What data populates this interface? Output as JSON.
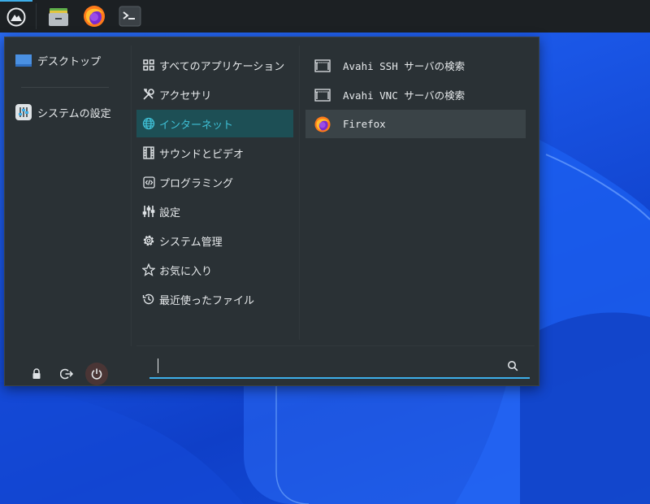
{
  "colors": {
    "accent": "#3daee9",
    "active_category_bg": "#1d4f55",
    "active_category_text": "#3fc0d6",
    "menu_bg": "#2a3135"
  },
  "taskbar": {
    "icons": [
      "whisker-menu-icon",
      "file-manager-icon",
      "firefox-icon",
      "terminal-icon"
    ]
  },
  "favorites": [
    {
      "label": "デスクトップ",
      "icon": "desktop-icon"
    },
    {
      "label": "システムの設定",
      "icon": "settings-manager-icon"
    }
  ],
  "categories": [
    {
      "label": "すべてのアプリケーション",
      "icon": "grid-icon"
    },
    {
      "label": "アクセサリ",
      "icon": "tools-icon"
    },
    {
      "label": "インターネット",
      "icon": "globe-icon",
      "selected": true
    },
    {
      "label": "サウンドとビデオ",
      "icon": "film-icon"
    },
    {
      "label": "プログラミング",
      "icon": "code-icon"
    },
    {
      "label": "設定",
      "icon": "sliders-icon"
    },
    {
      "label": "システム管理",
      "icon": "gear-icon"
    },
    {
      "label": "お気に入り",
      "icon": "star-icon"
    },
    {
      "label": "最近使ったファイル",
      "icon": "history-icon"
    }
  ],
  "apps": [
    {
      "label": "Avahi SSH サーバの検索",
      "icon": "network-window-icon"
    },
    {
      "label": "Avahi VNC サーバの検索",
      "icon": "network-window-icon"
    },
    {
      "label": "Firefox",
      "icon": "firefox-icon",
      "selected": true
    }
  ],
  "bottom_actions": [
    "lock-icon",
    "logout-icon",
    "power-icon"
  ],
  "search": {
    "value": ""
  }
}
